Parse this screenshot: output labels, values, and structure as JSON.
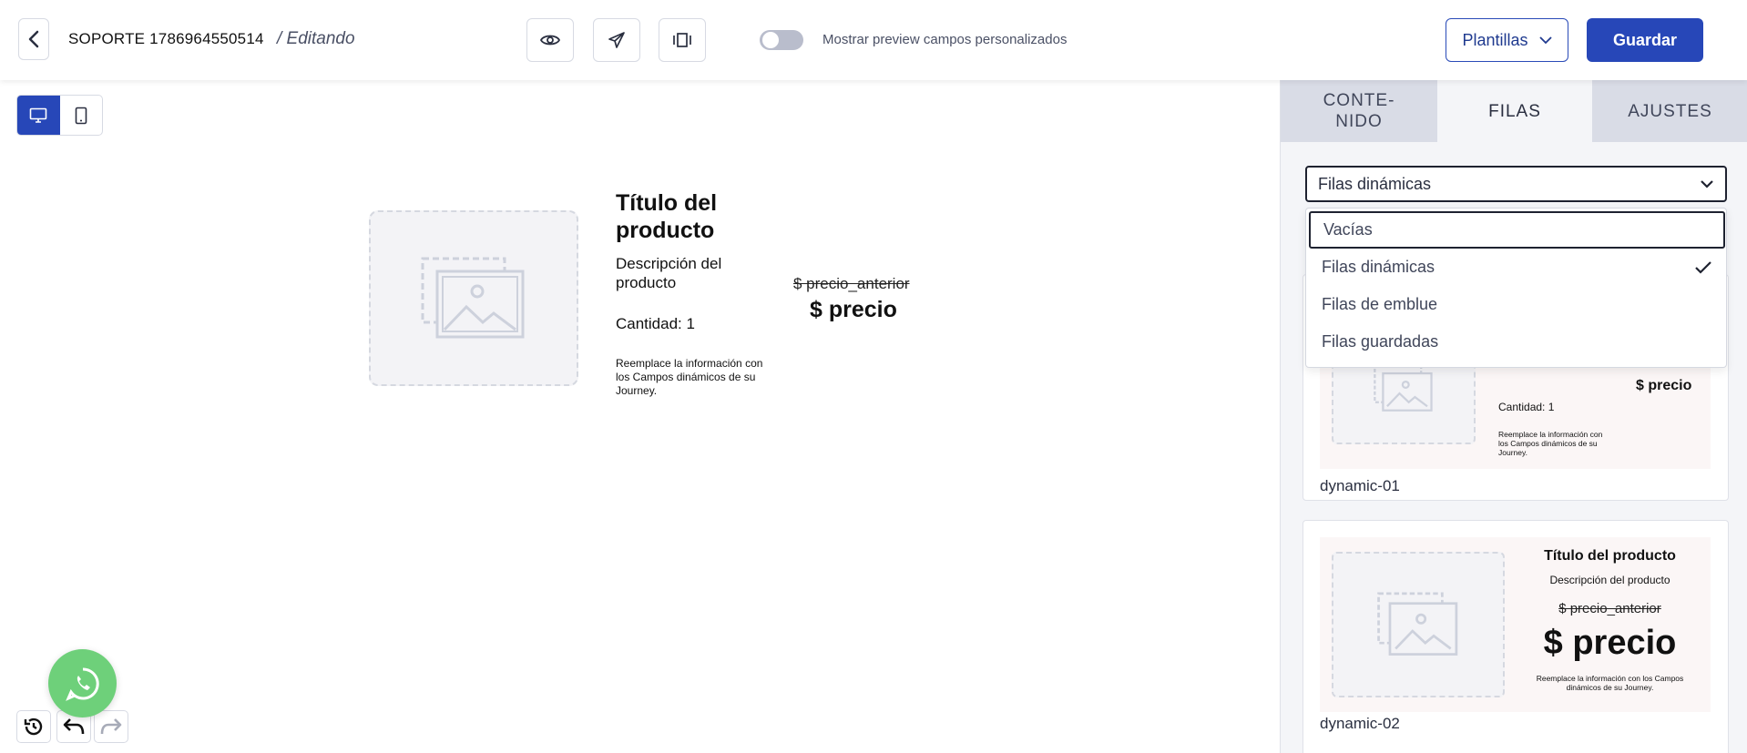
{
  "header": {
    "back_icon": "chevron-left-icon",
    "title": "SOPORTE 1786964550514",
    "status": "/ Editando",
    "icons": [
      "eye-icon",
      "send-icon",
      "layers-icon"
    ],
    "toggle_label": "Mostrar preview campos personalizados",
    "toggle_on": false,
    "templates_label": "Plantillas",
    "save_label": "Guardar",
    "accent": "#2747b8"
  },
  "device": {
    "desktop_icon": "desktop-icon",
    "mobile_icon": "mobile-icon",
    "active": "desktop"
  },
  "product": {
    "title": "Título del producto",
    "description": "Descripción del producto",
    "quantity": "Cantidad: 1",
    "note": "Reemplace la información con los Campos dinámicos de su Journey.",
    "old_price": "$ precio_anterior",
    "price": "$ precio"
  },
  "sidebar": {
    "tabs": [
      {
        "label": "CONTE-\nNIDO",
        "active": false
      },
      {
        "label": "FILAS",
        "active": true
      },
      {
        "label": "AJUSTES",
        "active": false
      }
    ],
    "select": {
      "value": "Filas dinámicas"
    },
    "dropdown": {
      "items": [
        {
          "label": "Vacías",
          "focused": true,
          "selected": false
        },
        {
          "label": "Filas dinámicas",
          "focused": false,
          "selected": true
        },
        {
          "label": "Filas de emblue",
          "focused": false,
          "selected": false
        },
        {
          "label": "Filas guardadas",
          "focused": false,
          "selected": false
        }
      ]
    },
    "cards": [
      {
        "name": "dynamic-01",
        "quantity": "Cantidad: 1",
        "note": "Reemplace la información con los Campos dinámicos de su Journey.",
        "price": "$ precio"
      },
      {
        "name": "dynamic-02",
        "title": "Título del producto",
        "description": "Descripción del producto",
        "old_price": "$ precio_anterior",
        "price": "$ precio",
        "note": "Reemplace la información con los Campos dinámicos de su Journey."
      }
    ]
  },
  "floating": {
    "whatsapp_icon": "whatsapp-icon",
    "color": "#6ed07a"
  },
  "history": {
    "icons": [
      "history-icon",
      "undo-icon",
      "redo-icon"
    ]
  }
}
